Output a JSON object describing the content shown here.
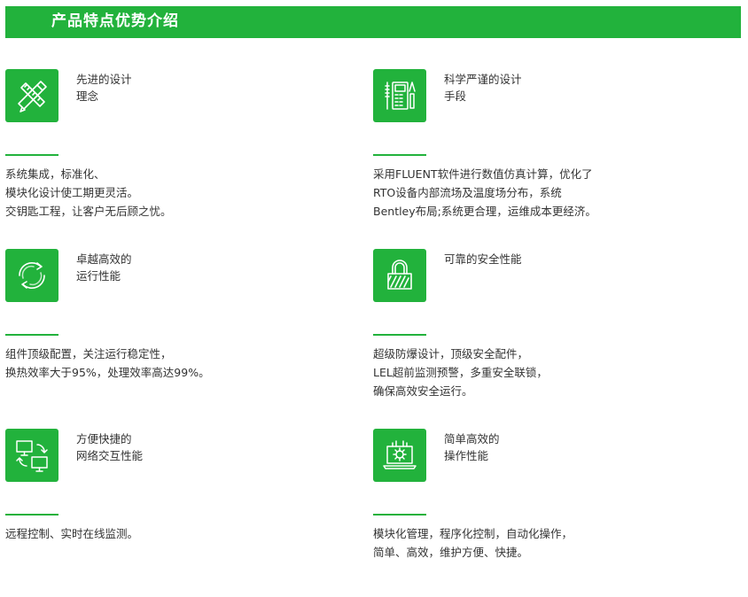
{
  "header": {
    "title": "产品特点优势介绍"
  },
  "features": [
    {
      "icon": "pencil-ruler-icon",
      "title_lines": [
        "先进的设计",
        "理念"
      ],
      "desc_lines": [
        "系统集成，标准化、",
        "模块化设计使工期更灵活。",
        "交钥匙工程，让客户无后顾之忧。"
      ]
    },
    {
      "icon": "instruments-icon",
      "title_lines": [
        "科学严谨的设计",
        "手段"
      ],
      "desc_lines": [
        "采用FLUENT软件进行数值仿真计算，优化了",
        "RTO设备内部流场及温度场分布，系统",
        "Bentley布局;系统更合理，运维成本更经济。"
      ]
    },
    {
      "icon": "cycle-arrows-icon",
      "title_lines": [
        "卓越高效的",
        "运行性能"
      ],
      "desc_lines": [
        "组件顶级配置，关注运行稳定性，",
        "换热效率大于95%，处理效率高达99%。"
      ]
    },
    {
      "icon": "padlock-icon",
      "title_lines": [
        "可靠的安全性能"
      ],
      "desc_lines": [
        "超级防爆设计，顶级安全配件，",
        "LEL超前监测预警，多重安全联锁，",
        "确保高效安全运行。"
      ]
    },
    {
      "icon": "network-monitors-icon",
      "title_lines": [
        "方便快捷的",
        "网络交互性能"
      ],
      "desc_lines": [
        "远程控制、实时在线监测。"
      ]
    },
    {
      "icon": "laptop-gear-icon",
      "title_lines": [
        "简单高效的",
        "操作性能"
      ],
      "desc_lines": [
        "模块化管理，程序化控制，自动化操作，",
        "简单、高效，维护方便、快捷。"
      ]
    }
  ],
  "colors": {
    "accent": "#22b23c",
    "text": "#333333",
    "header_text": "#ffffff"
  }
}
